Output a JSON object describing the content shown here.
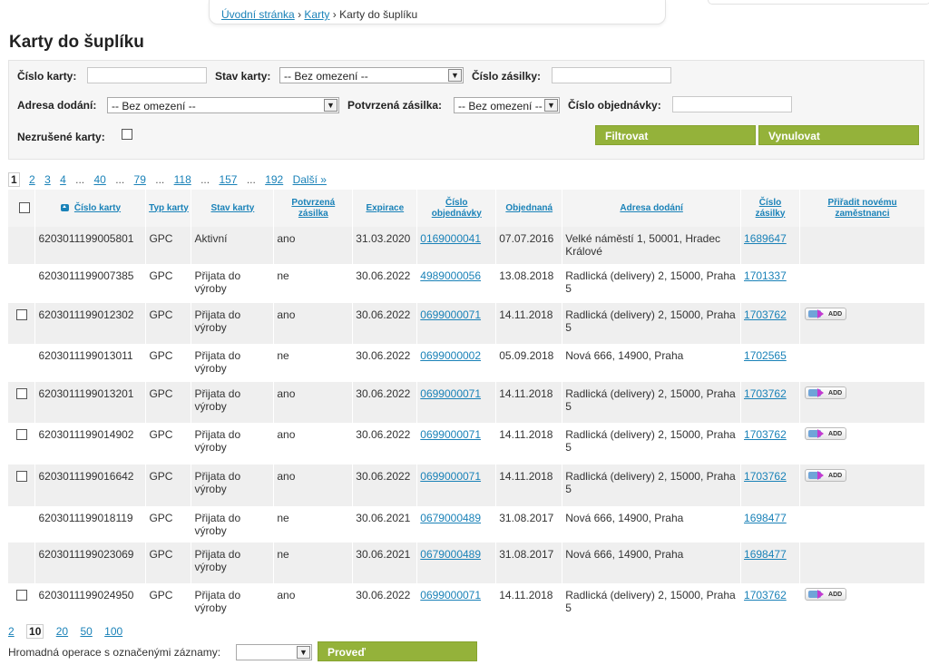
{
  "breadcrumb": {
    "home": "Úvodní stránka",
    "sep1": "›",
    "cards": "Karty",
    "sep2": "›",
    "current": "Karty do šuplíku"
  },
  "page_title": "Karty do šuplíku",
  "filters": {
    "card_number_label": "Číslo karty:",
    "card_number_value": "",
    "card_state_label": "Stav karty:",
    "card_state_value": "-- Bez omezení --",
    "shipment_number_label": "Číslo zásilky:",
    "shipment_number_value": "",
    "delivery_address_label": "Adresa dodání:",
    "delivery_address_value": "-- Bez omezení --",
    "confirmed_shipment_label": "Potvrzená zásilka:",
    "confirmed_shipment_value": "-- Bez omezení --",
    "order_number_label": "Číslo objednávky:",
    "order_number_value": "",
    "not_cancelled_label": "Nezrušené karty:",
    "filter_button": "Filtrovat",
    "reset_button": "Vynulovat"
  },
  "pagination": {
    "pages": [
      "1",
      "2",
      "3",
      "4",
      "...",
      "40",
      "...",
      "79",
      "...",
      "118",
      "...",
      "157",
      "...",
      "192"
    ],
    "current": "1",
    "next": "Další »"
  },
  "table": {
    "headers": {
      "card_number": "Číslo karty",
      "card_type": "Typ karty",
      "card_state": "Stav karty",
      "confirmed": "Potvrzená zásilka",
      "expiry": "Expirace",
      "order_number": "Číslo objednávky",
      "ordered": "Objednaná",
      "address": "Adresa dodání",
      "shipment_number": "Číslo zásilky",
      "assign": "Přiřadit novému zaměstnanci"
    },
    "rows": [
      {
        "checkbox": false,
        "card": "6203011199005801",
        "type": "GPC",
        "state": "Aktivní",
        "confirmed": "ano",
        "expiry": "31.03.2020",
        "order": "0169000041",
        "ordered": "07.07.2016",
        "address": "Velké náměstí 1, 50001, Hradec Králové",
        "shipment": "1689647",
        "add": false
      },
      {
        "checkbox": false,
        "card": "6203011199007385",
        "type": "GPC",
        "state": "Přijata do výroby",
        "confirmed": "ne",
        "expiry": "30.06.2022",
        "order": "4989000056",
        "ordered": "13.08.2018",
        "address": "Radlická (delivery) 2, 15000, Praha 5",
        "shipment": "1701337",
        "add": false
      },
      {
        "checkbox": true,
        "card": "6203011199012302",
        "type": "GPC",
        "state": "Přijata do výroby",
        "confirmed": "ano",
        "expiry": "30.06.2022",
        "order": "0699000071",
        "ordered": "14.11.2018",
        "address": "Radlická (delivery) 2, 15000, Praha 5",
        "shipment": "1703762",
        "add": true
      },
      {
        "checkbox": false,
        "card": "6203011199013011",
        "type": "GPC",
        "state": "Přijata do výroby",
        "confirmed": "ne",
        "expiry": "30.06.2022",
        "order": "0699000002",
        "ordered": "05.09.2018",
        "address": "Nová 666, 14900, Praha",
        "shipment": "1702565",
        "add": false
      },
      {
        "checkbox": true,
        "card": "6203011199013201",
        "type": "GPC",
        "state": "Přijata do výroby",
        "confirmed": "ano",
        "expiry": "30.06.2022",
        "order": "0699000071",
        "ordered": "14.11.2018",
        "address": "Radlická (delivery) 2, 15000, Praha 5",
        "shipment": "1703762",
        "add": true
      },
      {
        "checkbox": true,
        "card": "6203011199014902",
        "type": "GPC",
        "state": "Přijata do výroby",
        "confirmed": "ano",
        "expiry": "30.06.2022",
        "order": "0699000071",
        "ordered": "14.11.2018",
        "address": "Radlická (delivery) 2, 15000, Praha 5",
        "shipment": "1703762",
        "add": true
      },
      {
        "checkbox": true,
        "card": "6203011199016642",
        "type": "GPC",
        "state": "Přijata do výroby",
        "confirmed": "ano",
        "expiry": "30.06.2022",
        "order": "0699000071",
        "ordered": "14.11.2018",
        "address": "Radlická (delivery) 2, 15000, Praha 5",
        "shipment": "1703762",
        "add": true
      },
      {
        "checkbox": false,
        "card": "6203011199018119",
        "type": "GPC",
        "state": "Přijata do výroby",
        "confirmed": "ne",
        "expiry": "30.06.2021",
        "order": "0679000489",
        "ordered": "31.08.2017",
        "address": "Nová 666, 14900, Praha",
        "shipment": "1698477",
        "add": false
      },
      {
        "checkbox": false,
        "card": "6203011199023069",
        "type": "GPC",
        "state": "Přijata do výroby",
        "confirmed": "ne",
        "expiry": "30.06.2021",
        "order": "0679000489",
        "ordered": "31.08.2017",
        "address": "Nová 666, 14900, Praha",
        "shipment": "1698477",
        "add": false
      },
      {
        "checkbox": true,
        "card": "6203011199024950",
        "type": "GPC",
        "state": "Přijata do výroby",
        "confirmed": "ano",
        "expiry": "30.06.2022",
        "order": "0699000071",
        "ordered": "14.11.2018",
        "address": "Radlická (delivery) 2, 15000, Praha 5",
        "shipment": "1703762",
        "add": true
      }
    ],
    "add_button_label": "ADD"
  },
  "per_page": {
    "options": [
      "2",
      "10",
      "20",
      "50",
      "100"
    ],
    "current": "10"
  },
  "bulk": {
    "label": "Hromadná operace s označenými záznamy:",
    "select_value": "",
    "button": "Proveď"
  },
  "colors": {
    "accent_green": "#94b23a",
    "link_blue": "#1a82b8"
  }
}
